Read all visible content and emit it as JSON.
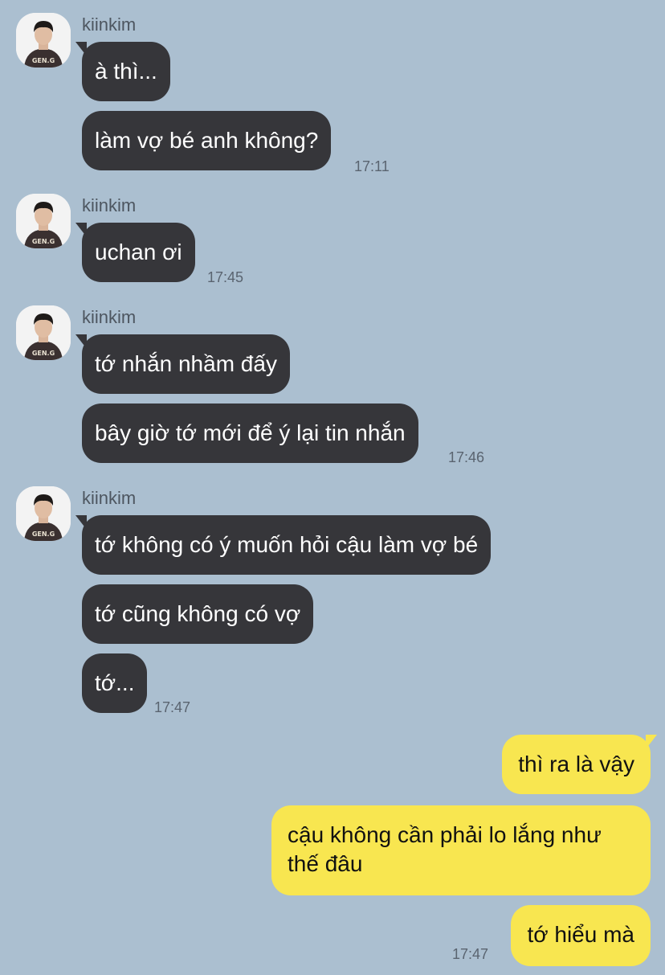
{
  "groups": [
    {
      "sender": "kiinkim",
      "messages": [
        "à thì...",
        "làm vợ bé anh không?"
      ],
      "time": "17:11"
    },
    {
      "sender": "kiinkim",
      "messages": [
        "uchan ơi"
      ],
      "time": "17:45"
    },
    {
      "sender": "kiinkim",
      "messages": [
        "tớ nhắn nhầm đấy",
        "bây giờ tớ mới để ý lại tin nhắn"
      ],
      "time": "17:46"
    },
    {
      "sender": "kiinkim",
      "messages": [
        "tớ không có ý muốn hỏi cậu làm vợ bé",
        "tớ cũng không có vợ",
        "tớ..."
      ],
      "time": "17:47"
    }
  ],
  "mine": {
    "messages": [
      "thì ra là vậy",
      "cậu không cần phải lo lắng như thế đâu",
      "tớ hiểu mà"
    ],
    "time": "17:47"
  },
  "avatar": {
    "icon": "profile-photo",
    "jersey_text": "GEN.G"
  },
  "colors": {
    "background": "#abbfd0",
    "incoming_bubble": "#36363a",
    "outgoing_bubble": "#f8e650"
  }
}
